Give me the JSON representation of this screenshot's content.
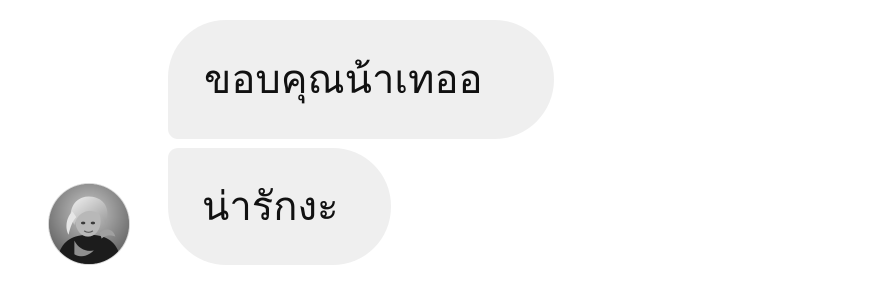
{
  "chat": {
    "messages": [
      {
        "text": "ขอบคุณน้าเทออ"
      },
      {
        "text": "น่ารักงะ"
      }
    ],
    "avatar_icon": "user-avatar-photo"
  },
  "colors": {
    "bubble_background": "#efefef",
    "text": "#111111",
    "page_background": "#ffffff"
  }
}
